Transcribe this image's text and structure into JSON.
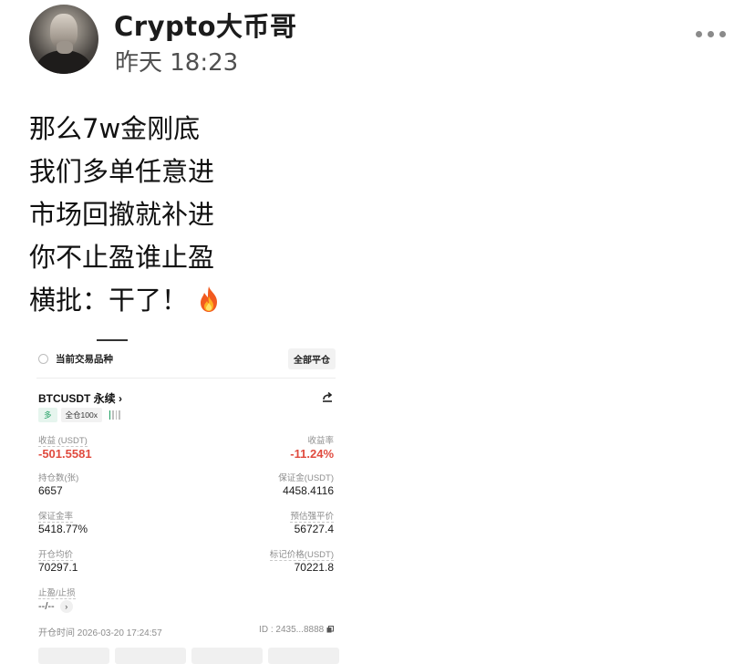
{
  "post": {
    "author": "Crypto大币哥",
    "time": "昨天 18:23",
    "more_icon": "ellipsis-icon",
    "lines": [
      "那么7w金刚底",
      "我们多单任意进",
      "市场回撤就补进",
      "你不止盈谁止盈",
      "横批：干了！"
    ],
    "emoji": "fire-icon"
  },
  "position": {
    "current_label": "当前交易品种",
    "close_all_label": "全部平仓",
    "symbol": "BTCUSDT 永续",
    "symbol_chevron": "›",
    "side_badge": "多",
    "margin_badge": "全仓100x",
    "leverage_level_fraction": 0.25,
    "pnl_label": "收益 (USDT)",
    "pnl_value": "-501.5581",
    "roi_label": "收益率",
    "roi_value": "-11.24%",
    "size_label": "持仓数(张)",
    "size_value": "6657",
    "margin_label": "保证金(USDT)",
    "margin_value": "4458.4116",
    "margin_ratio_label": "保证金率",
    "margin_ratio_value": "5418.77%",
    "liq_label": "预估强平价",
    "liq_value": "56727.4",
    "entry_label": "开仓均价",
    "entry_value": "70297.1",
    "mark_label": "标记价格(USDT)",
    "mark_value": "70221.8",
    "tpsl_label": "止盈/止损",
    "tpsl_value": "--/--",
    "tpsl_chevron": "›",
    "open_time": "开仓时间 2026-03-20 17:24:57",
    "id_text": "ID : 2435...8888"
  },
  "colors": {
    "negative": "#e04b3f",
    "long_green": "#1e9e61",
    "muted": "#8d8d8d"
  }
}
